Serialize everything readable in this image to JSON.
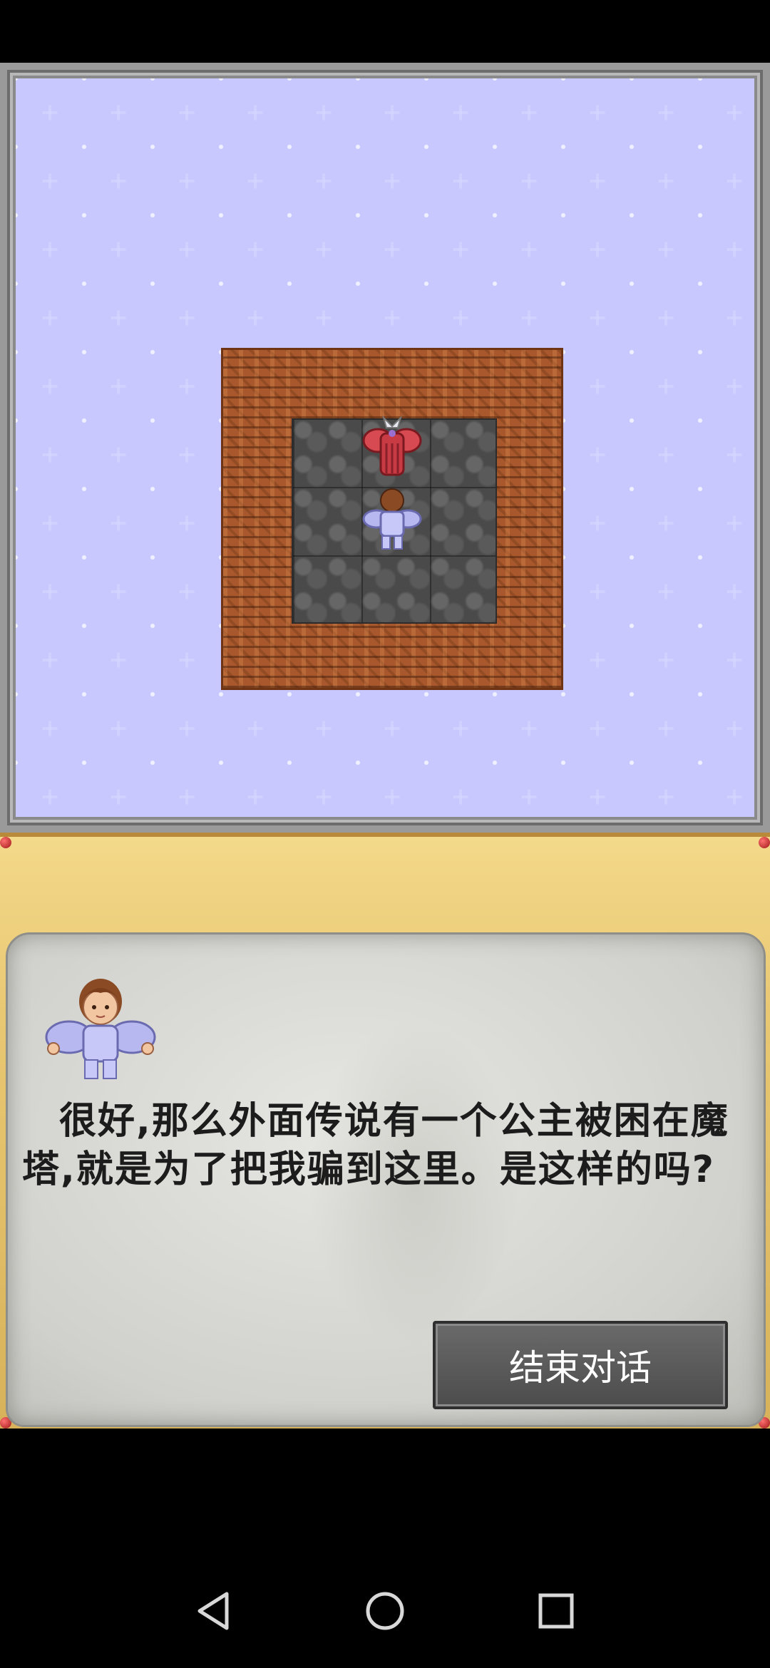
{
  "map": {
    "tiles": [
      "starfield",
      "brick-wall",
      "stone-floor"
    ],
    "sprites": [
      "demon-king",
      "hero"
    ]
  },
  "dialog": {
    "speaker_portrait": "hero-portrait",
    "text": "很好,那么外面传说有一个公主被困在魔塔,就是为了把我骗到这里。是这样的吗?",
    "end_button": "结束对话"
  },
  "navbar": {
    "back": "back-icon",
    "home": "home-icon",
    "recent": "recent-apps-icon"
  },
  "colors": {
    "space": "#111014",
    "brick": "#a8582c",
    "floor": "#4a4a4a",
    "dialog_gold": "#e9c873",
    "scroll": "#d6d6d2",
    "button": "#555555"
  }
}
